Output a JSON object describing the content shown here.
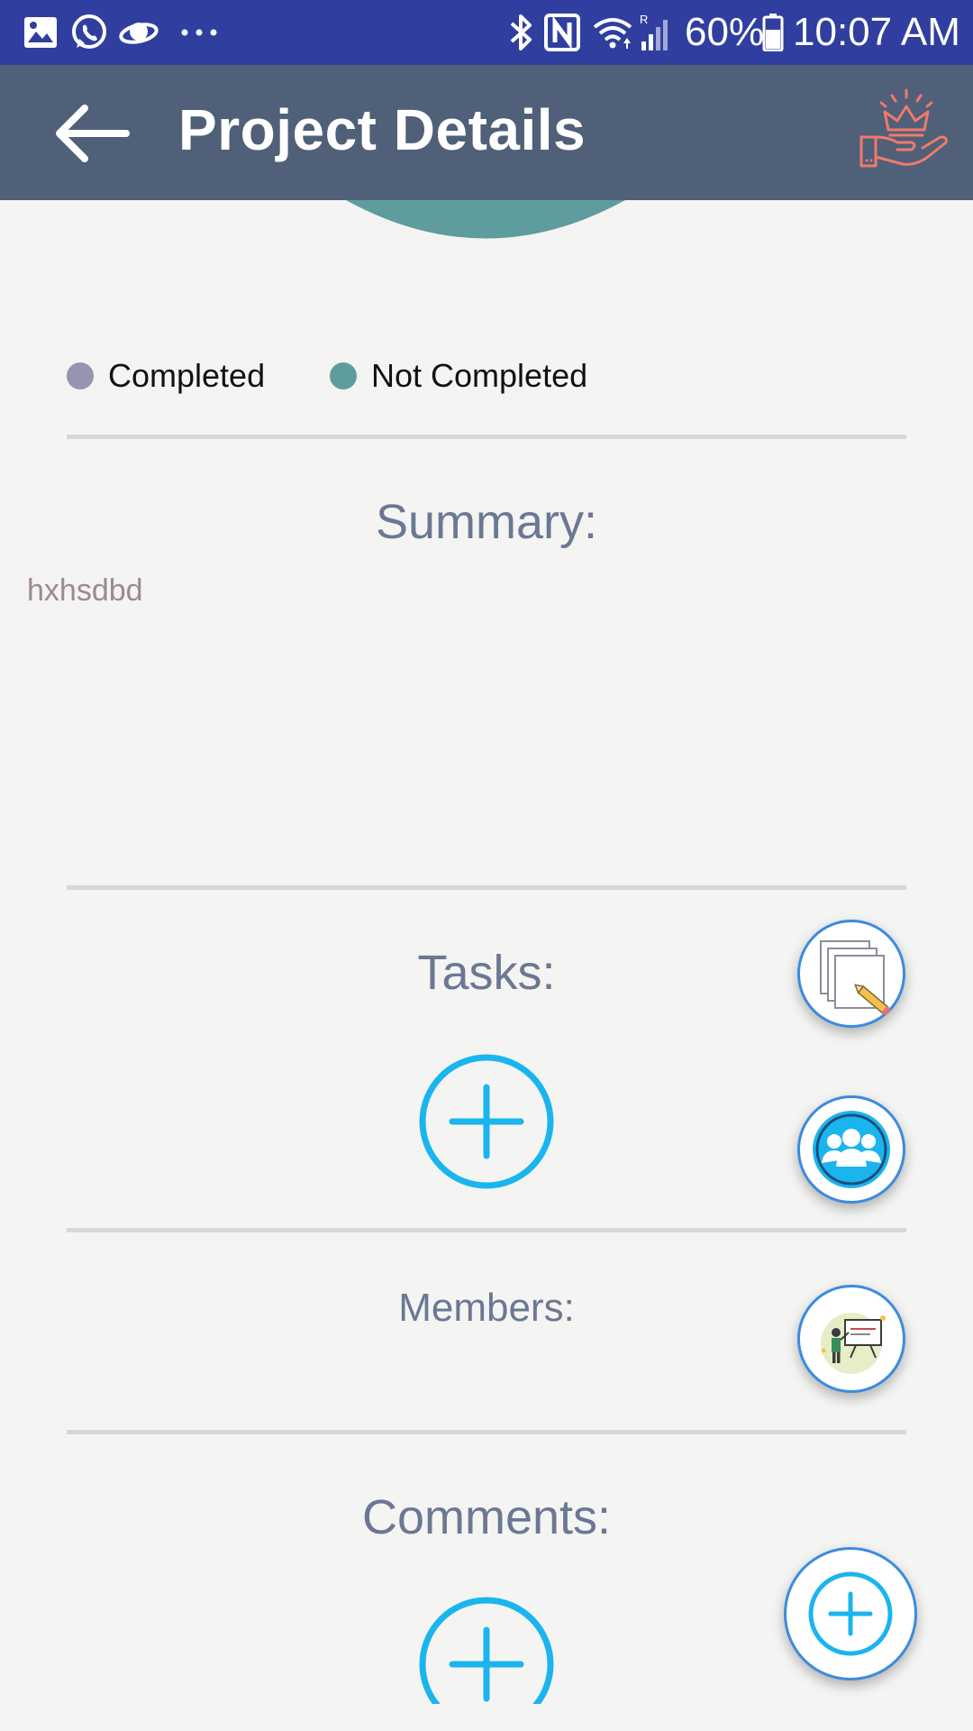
{
  "status_bar": {
    "battery": "60%",
    "time": "10:07 AM",
    "notification_icons": [
      "gallery-icon",
      "whatsapp-icon",
      "planet-icon",
      "more-icon"
    ],
    "system_icons": [
      "bluetooth-icon",
      "nfc-icon",
      "wifi-icon",
      "signal-icon",
      "battery-icon"
    ],
    "bg_color": "#303f9f"
  },
  "app_bar": {
    "title": "Project Details",
    "back_icon": "arrow-back-icon",
    "action_icon": "crown-hand-icon",
    "bg_color": "#4f6078"
  },
  "legend": [
    {
      "label": "Completed",
      "color": "#9496b0"
    },
    {
      "label": "Not Completed",
      "color": "#5f9c9d"
    }
  ],
  "summary": {
    "title": "Summary:",
    "text": "hxhsdbd"
  },
  "tasks": {
    "title": "Tasks:",
    "add_icon": "add-circle-icon"
  },
  "members": {
    "title": "Members:"
  },
  "comments": {
    "title": "Comments:",
    "add_icon": "add-circle-icon"
  },
  "fabs": [
    {
      "name": "edit-tasks",
      "icon": "notes-pencil-icon"
    },
    {
      "name": "team",
      "icon": "group-icon"
    },
    {
      "name": "presentation",
      "icon": "presentation-icon"
    },
    {
      "name": "add",
      "icon": "plus-icon"
    }
  ],
  "accent_color": "#1ab5ee"
}
